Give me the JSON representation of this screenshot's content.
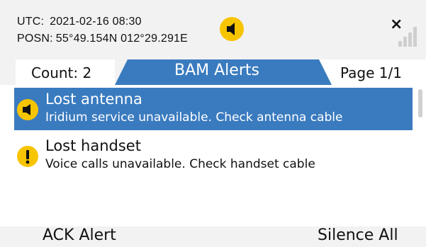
{
  "status": {
    "utc_label": "UTC:",
    "utc_value": "2021-02-16  08:30",
    "posn_label": "POSN:",
    "posn_value": "55°49.154N  012°29.291E",
    "alarm_icon": "speaker-icon",
    "signal_icon": "signal-bars-icon",
    "signal_status_icon": "close-icon"
  },
  "header": {
    "count_label": "Count: 2",
    "title": "BAM Alerts",
    "page_label": "Page 1/1"
  },
  "alerts": [
    {
      "title": "Lost antenna",
      "description": "Iridium service unavailable. Check antenna cable",
      "icon": "speaker-icon",
      "selected": true
    },
    {
      "title": "Lost handset",
      "description": "Voice calls unavailable. Check handset cable",
      "icon": "exclamation-icon",
      "selected": false
    }
  ],
  "softkeys": {
    "left": "ACK Alert",
    "right": "Silence All"
  },
  "colors": {
    "accent_blue": "#3a7bbf",
    "alert_yellow": "#f7c400",
    "background": "#f2f2f2"
  }
}
